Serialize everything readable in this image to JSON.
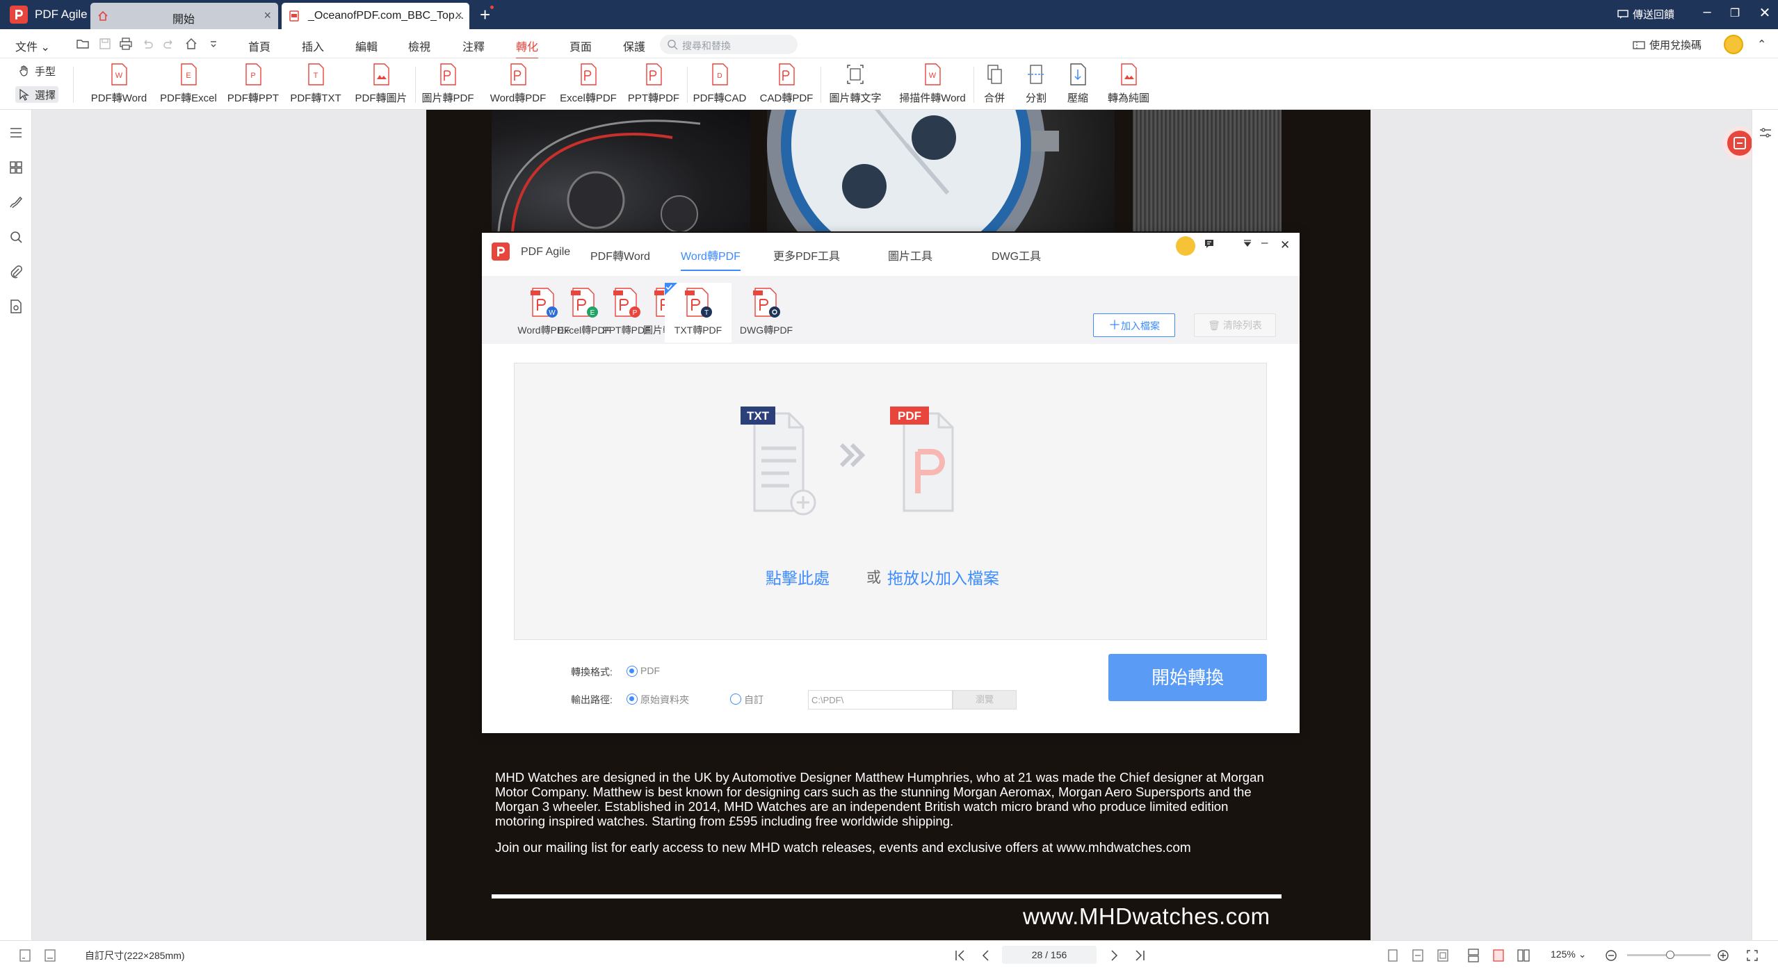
{
  "app": {
    "name": "PDF Agile"
  },
  "tabs": [
    {
      "label": "開始"
    },
    {
      "label": "_OceanofPDF.com_BBC_Top..."
    }
  ],
  "titlebar": {
    "feedback": "傳送回饋"
  },
  "menubar": {
    "file": "文件",
    "items": [
      "首頁",
      "插入",
      "編輯",
      "檢視",
      "注釋",
      "轉化",
      "頁面",
      "保護"
    ],
    "active": "轉化",
    "search_placeholder": "搜尋和替換",
    "redeem": "使用兌換碼"
  },
  "ribbon": {
    "modes": [
      "手型",
      "選擇"
    ],
    "tools": [
      "PDF轉Word",
      "PDF轉Excel",
      "PDF轉PPT",
      "PDF轉TXT",
      "PDF轉圖片",
      "圖片轉PDF",
      "Word轉PDF",
      "Excel轉PDF",
      "PPT轉PDF",
      "PDF轉CAD",
      "CAD轉PDF",
      "圖片轉文字",
      "掃描件轉Word",
      "合併",
      "分割",
      "壓縮",
      "轉為純圖"
    ]
  },
  "document": {
    "description": "MHD Watches are designed in the UK by Automotive Designer Matthew Humphries, who at 21 was made the Chief designer at Morgan Motor Company.  Matthew is best known for designing cars such as the stunning Morgan Aeromax, Morgan Aero Supersports and the Morgan 3 wheeler.  Established in 2014, MHD Watches are an independent British watch micro brand who produce limited edition motoring inspired watches. Starting from £595 including free worldwide shipping.",
    "mailing": "Join our mailing list for early access to new MHD watch releases, events and exclusive offers at www.mhdwatches.com",
    "website": "www.MHDwatches.com"
  },
  "dialog": {
    "app_name": "PDF Agile",
    "tabs": [
      "PDF轉Word",
      "Word轉PDF",
      "更多PDF工具",
      "圖片工具",
      "DWG工具"
    ],
    "active_tab": "Word轉PDF",
    "tools": [
      {
        "label": "Word轉PDF",
        "badge": "W",
        "color": "#2b6fd6"
      },
      {
        "label": "Excel轉PDF",
        "badge": "E",
        "color": "#21a366"
      },
      {
        "label": "PPT轉PDF",
        "badge": "P",
        "color": "#e8453c"
      },
      {
        "label": "圖片轉PDF",
        "badge": "",
        "color": "#e8453c"
      },
      {
        "label": "TXT轉PDF",
        "badge": "T",
        "color": "#1f3459"
      },
      {
        "label": "DWG轉PDF",
        "badge": "",
        "color": "#1f3459"
      }
    ],
    "active_tool": "TXT轉PDF",
    "add_button": "加入檔案",
    "clear_button": "清除列表",
    "drop": {
      "from_badge": "TXT",
      "to_badge": "PDF",
      "click": "點擊此處",
      "or": "或",
      "drag": "拖放以加入檔案"
    },
    "format_label": "轉換格式:",
    "format_value": "PDF",
    "output_label": "輸出路徑:",
    "output_option_original": "原始資料夾",
    "output_option_custom": "自訂",
    "output_path": "C:\\PDF\\",
    "browse_button": "瀏覽",
    "start_button": "開始轉換"
  },
  "statusbar": {
    "page_size": "自訂尺寸(222×285mm)",
    "page_indicator": "28 / 156",
    "zoom": "125%"
  }
}
